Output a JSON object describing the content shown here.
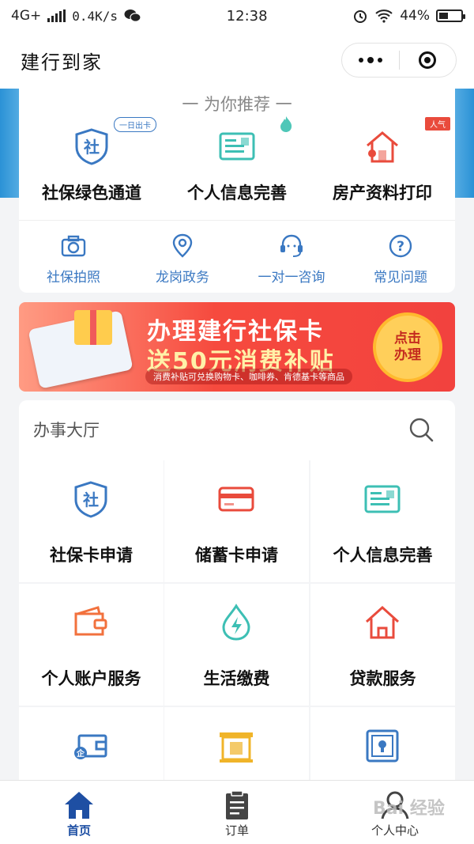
{
  "status_bar": {
    "network": "4G+",
    "speed": "0.4K/s",
    "time": "12:38",
    "battery": "44%",
    "battery_level": 0.44
  },
  "nav": {
    "title": "建行到家"
  },
  "recommend": {
    "title": "一 为你推荐 一",
    "items": [
      {
        "label": "社保绿色通道",
        "icon": "social-security-shield-icon",
        "tag": "一日出卡"
      },
      {
        "label": "个人信息完善",
        "icon": "id-card-icon",
        "tag": ""
      },
      {
        "label": "房产资料打印",
        "icon": "house-print-icon",
        "tag": "人气"
      }
    ],
    "quick": [
      {
        "label": "社保拍照",
        "icon": "camera-icon"
      },
      {
        "label": "龙岗政务",
        "icon": "location-pin-icon"
      },
      {
        "label": "一对一咨询",
        "icon": "headset-icon"
      },
      {
        "label": "常见问题",
        "icon": "question-icon"
      }
    ]
  },
  "promo": {
    "line1": "办理建行社保卡",
    "line2": "送50元消费补贴",
    "line3": "消费补贴可兑换购物卡、咖啡券、肯德基卡等商品",
    "button": "点击办理"
  },
  "hall": {
    "title": "办事大厅",
    "tiles": [
      {
        "label": "社保卡申请",
        "icon": "social-security-shield-icon"
      },
      {
        "label": "储蓄卡申请",
        "icon": "bank-card-icon"
      },
      {
        "label": "个人信息完善",
        "icon": "id-card-icon"
      },
      {
        "label": "个人账户服务",
        "icon": "wallet-icon"
      },
      {
        "label": "生活缴费",
        "icon": "water-drop-bolt-icon"
      },
      {
        "label": "贷款服务",
        "icon": "house-icon"
      },
      {
        "label": "",
        "icon": "enterprise-wallet-icon"
      },
      {
        "label": "",
        "icon": "gate-icon"
      },
      {
        "label": "",
        "icon": "safe-lock-icon"
      }
    ]
  },
  "tabbar": {
    "items": [
      {
        "label": "首页",
        "icon": "home-icon",
        "active": true
      },
      {
        "label": "订单",
        "icon": "order-clipboard-icon",
        "active": false
      },
      {
        "label": "个人中心",
        "icon": "user-center-icon",
        "active": false
      }
    ]
  },
  "watermark": "Bai 经验",
  "colors": {
    "accent_blue": "#3a78c2",
    "tab_active": "#1e4fa3",
    "red": "#e94b3c",
    "teal": "#3dbfb4"
  }
}
